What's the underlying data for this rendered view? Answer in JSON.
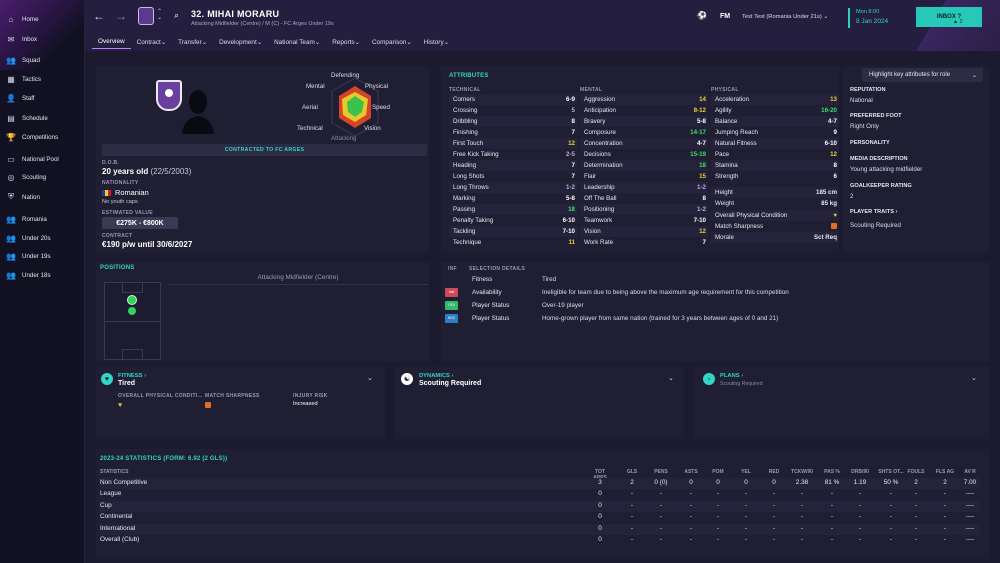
{
  "sidebar": {
    "items": [
      {
        "label": "Home",
        "icon": "home-icon",
        "glyph": "⌂"
      },
      {
        "label": "Inbox",
        "icon": "inbox-icon",
        "glyph": "✉"
      },
      {
        "label": "Squad",
        "icon": "squad-icon",
        "glyph": "👥"
      },
      {
        "label": "Tactics",
        "icon": "tactics-icon",
        "glyph": "▦"
      },
      {
        "label": "Staff",
        "icon": "staff-icon",
        "glyph": "👤"
      },
      {
        "label": "Schedule",
        "icon": "schedule-icon",
        "glyph": "▤"
      },
      {
        "label": "Competitions",
        "icon": "trophy-icon",
        "glyph": "🏆"
      },
      {
        "label": "National Pool",
        "icon": "national-pool-icon",
        "glyph": "▭"
      },
      {
        "label": "Scouting",
        "icon": "scouting-icon",
        "glyph": "◎"
      },
      {
        "label": "Nation",
        "icon": "nation-icon",
        "glyph": "⛨"
      },
      {
        "label": "Romania",
        "icon": "team-icon",
        "glyph": "👥"
      },
      {
        "label": "Under 20s",
        "icon": "team-icon",
        "glyph": "👥"
      },
      {
        "label": "Under 19s",
        "icon": "team-icon",
        "glyph": "👥"
      },
      {
        "label": "Under 18s",
        "icon": "team-icon",
        "glyph": "👥"
      }
    ]
  },
  "header": {
    "player_name": "32. MIHAI MORARU",
    "player_subtitle": "Attacking Midfielder (Centre) / M (C) - FC Arges Under 19s",
    "fm_label": "FM",
    "manager_label": "Test Test (Romania Under 21s)",
    "time": "Mon 8:00",
    "date": "8 Jan 2024",
    "inbox_label": "INBOX",
    "inbox_count": "2",
    "tabs": [
      "Overview",
      "Contract",
      "Transfer",
      "Development",
      "National Team",
      "Reports",
      "Comparison",
      "History"
    ]
  },
  "profile": {
    "contracted": "CONTRACTED TO FC ARGES",
    "dob_label": "D.O.B.",
    "dob_value": "20 years old",
    "dob_date": "(22/5/2003)",
    "nationality_label": "NATIONALITY",
    "nationality": "Romanian",
    "youth_caps": "No youth caps",
    "estimated_value_label": "ESTIMATED VALUE",
    "estimated_value": "€275K - €800K",
    "contract_label": "CONTRACT",
    "contract_value": "€190 p/w until 30/6/2027",
    "hex_labels": {
      "defending": "Defending",
      "mental": "Mental",
      "physical": "Physical",
      "aerial": "Aerial",
      "speed": "Speed",
      "technical": "Technical",
      "vision": "Vision",
      "attacking": "Attacking"
    },
    "colors": {
      "accent": "#33d6c4",
      "badge": "#6a3fa0"
    }
  },
  "attributes": {
    "title": "ATTRIBUTES",
    "technical_label": "TECHNICAL",
    "mental_label": "MENTAL",
    "physical_label": "PHYSICAL",
    "technical": [
      {
        "name": "Corners",
        "value": "6-9"
      },
      {
        "name": "Crossing",
        "value": "5"
      },
      {
        "name": "Dribbling",
        "value": "8"
      },
      {
        "name": "Finishing",
        "value": "7"
      },
      {
        "name": "First Touch",
        "value": "12"
      },
      {
        "name": "Free Kick Taking",
        "value": "2-5"
      },
      {
        "name": "Heading",
        "value": "7"
      },
      {
        "name": "Long Shots",
        "value": "7"
      },
      {
        "name": "Long Throws",
        "value": "1-2"
      },
      {
        "name": "Marking",
        "value": "5-8"
      },
      {
        "name": "Passing",
        "value": "18"
      },
      {
        "name": "Penalty Taking",
        "value": "6-10"
      },
      {
        "name": "Tackling",
        "value": "7-10"
      },
      {
        "name": "Technique",
        "value": "11"
      }
    ],
    "mental": [
      {
        "name": "Aggression",
        "value": "14"
      },
      {
        "name": "Anticipation",
        "value": "8-12"
      },
      {
        "name": "Bravery",
        "value": "5-8"
      },
      {
        "name": "Composure",
        "value": "14-17"
      },
      {
        "name": "Concentration",
        "value": "4-7"
      },
      {
        "name": "Decisions",
        "value": "15-19"
      },
      {
        "name": "Determination",
        "value": "18"
      },
      {
        "name": "Flair",
        "value": "15"
      },
      {
        "name": "Leadership",
        "value": "1-2"
      },
      {
        "name": "Off The Ball",
        "value": "8"
      },
      {
        "name": "Positioning",
        "value": "1-2"
      },
      {
        "name": "Teamwork",
        "value": "7-10"
      },
      {
        "name": "Vision",
        "value": "12"
      },
      {
        "name": "Work Rate",
        "value": "7"
      }
    ],
    "physical": [
      {
        "name": "Acceleration",
        "value": "13"
      },
      {
        "name": "Agility",
        "value": "16-20"
      },
      {
        "name": "Balance",
        "value": "4-7"
      },
      {
        "name": "Jumping Reach",
        "value": "9"
      },
      {
        "name": "Natural Fitness",
        "value": "6-10"
      },
      {
        "name": "Pace",
        "value": "12"
      },
      {
        "name": "Stamina",
        "value": "8"
      },
      {
        "name": "Strength",
        "value": "6"
      }
    ],
    "extra": [
      {
        "name": "Height",
        "value": "185 cm"
      },
      {
        "name": "Weight",
        "value": "85 kg"
      },
      {
        "name": "Overall Physical Condition",
        "value": ""
      },
      {
        "name": "Match Sharpness",
        "value": ""
      },
      {
        "name": "Morale",
        "value": "Sct Req"
      }
    ]
  },
  "right_panel": {
    "highlight_label": "Highlight key attributes for role",
    "reputation_label": "REPUTATION",
    "reputation": "National",
    "foot_label": "PREFERRED FOOT",
    "foot": "Right Only",
    "personality_label": "PERSONALITY",
    "media_label": "MEDIA DESCRIPTION",
    "media": "Young attacking midfielder",
    "gk_label": "GOALKEEPER RATING",
    "gk": "2",
    "traits_label": "PLAYER TRAITS",
    "traits": "Scouting Required"
  },
  "positions": {
    "title": "POSITIONS",
    "role": "Attacking Midfielder (Centre)"
  },
  "selection": {
    "inf_label": "INF",
    "details_label": "SELECTION DETAILS",
    "rows": [
      {
        "badge": "",
        "badge_color": "",
        "label": "Fitness",
        "value": "Tired"
      },
      {
        "badge": "Inel",
        "badge_color": "#d0495b",
        "label": "Availability",
        "value": "Ineligible for team due to being above the maximum age requirement for this competition"
      },
      {
        "badge": "O19",
        "badge_color": "#36b96e",
        "label": "Player Status",
        "value": "Over-19 player"
      },
      {
        "badge": "HGC",
        "badge_color": "#2d7fc4",
        "label": "Player Status",
        "value": "Home-grown player from same nation (trained for 3 years between ages of 0 and 21)"
      }
    ]
  },
  "cards": {
    "fitness_title": "FITNESS",
    "fitness_value": "Tired",
    "opc_label": "OVERALL PHYSICAL CONDITI...",
    "ms_label": "MATCH SHARPNESS",
    "injury_label": "INJURY RISK",
    "injury_value": "Increased",
    "dynamics_title": "DYNAMICS",
    "dynamics_value": "Scouting Required",
    "plans_title": "PLANS",
    "plans_value": "Scouting Required"
  },
  "stats": {
    "title": "2023-24 STATISTICS (FORM: 6.92 (2 GLS))",
    "headers": [
      "STATISTICS",
      "TOT APPS",
      "GLS",
      "PENS",
      "ASTS",
      "POM",
      "YEL",
      "RED",
      "TCKW/90",
      "PAS %",
      "DRB/90",
      "SHTS OT...",
      "FOULS",
      "FLS AG",
      "AV R"
    ],
    "rows": [
      [
        "Non Competitive",
        "3",
        "2",
        "0 (0)",
        "0",
        "0",
        "0",
        "0",
        "2.38",
        "81 %",
        "1.19",
        "50 %",
        "2",
        "2",
        "7.00"
      ],
      [
        "League",
        "0",
        "-",
        "-",
        "-",
        "-",
        "-",
        "-",
        "-",
        "-",
        "-",
        "-",
        "-",
        "-",
        "----"
      ],
      [
        "Cup",
        "0",
        "-",
        "-",
        "-",
        "-",
        "-",
        "-",
        "-",
        "-",
        "-",
        "-",
        "-",
        "-",
        "----"
      ],
      [
        "Continental",
        "0",
        "-",
        "-",
        "-",
        "-",
        "-",
        "-",
        "-",
        "-",
        "-",
        "-",
        "-",
        "-",
        "----"
      ],
      [
        "International",
        "0",
        "-",
        "-",
        "-",
        "-",
        "-",
        "-",
        "-",
        "-",
        "-",
        "-",
        "-",
        "-",
        "----"
      ],
      [
        "Overall (Club)",
        "0",
        "-",
        "-",
        "-",
        "-",
        "-",
        "-",
        "-",
        "-",
        "-",
        "-",
        "-",
        "-",
        "----"
      ]
    ]
  }
}
